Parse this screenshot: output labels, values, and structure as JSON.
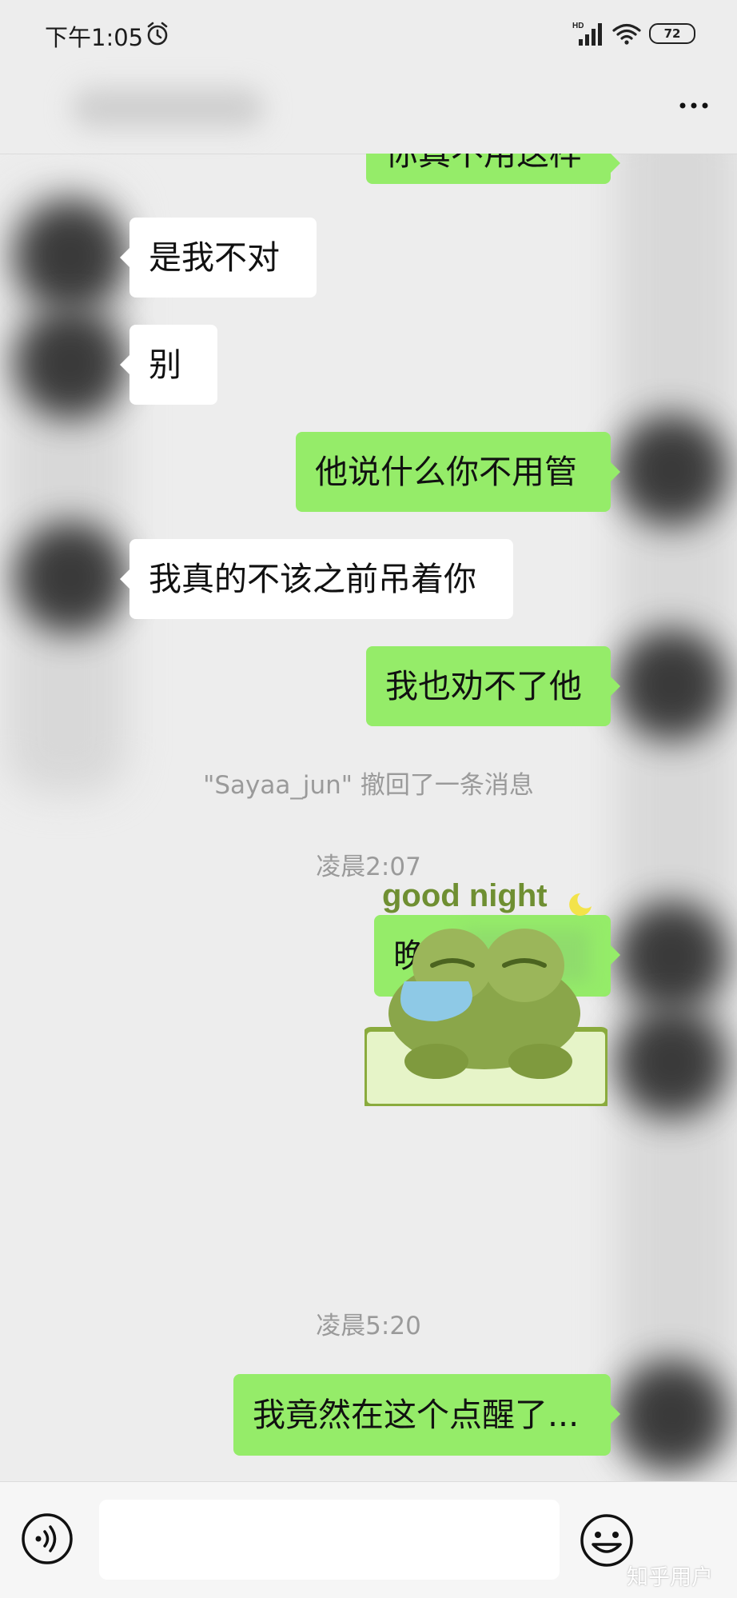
{
  "status_bar": {
    "time": "下午1:05",
    "network": "HD",
    "battery": "72"
  },
  "messages": [
    {
      "dir": "out",
      "text": "你真不用这样"
    },
    {
      "dir": "in",
      "text": "是我不对"
    },
    {
      "dir": "in",
      "text": "别"
    },
    {
      "dir": "out",
      "text": "他说什么你不用管"
    },
    {
      "dir": "in",
      "text": "我真的不该之前吊着你"
    },
    {
      "dir": "out",
      "text": "我也劝不了他"
    },
    {
      "dir": "out",
      "text": "晚安"
    },
    {
      "dir": "out",
      "text": "我竟然在这个点醒了..."
    }
  ],
  "system_notices": {
    "recall": "\"Sayaa_jun\" 撤回了一条消息",
    "time1": "凌晨2:07",
    "time2": "凌晨5:20"
  },
  "sticker": {
    "text": "good night",
    "icon": "frog-sticker"
  },
  "input_bar": {
    "placeholder": ""
  },
  "watermark": "知乎用户",
  "colors": {
    "outgoing_bubble": "#95ec69",
    "incoming_bubble": "#ffffff",
    "background": "#ededed"
  }
}
